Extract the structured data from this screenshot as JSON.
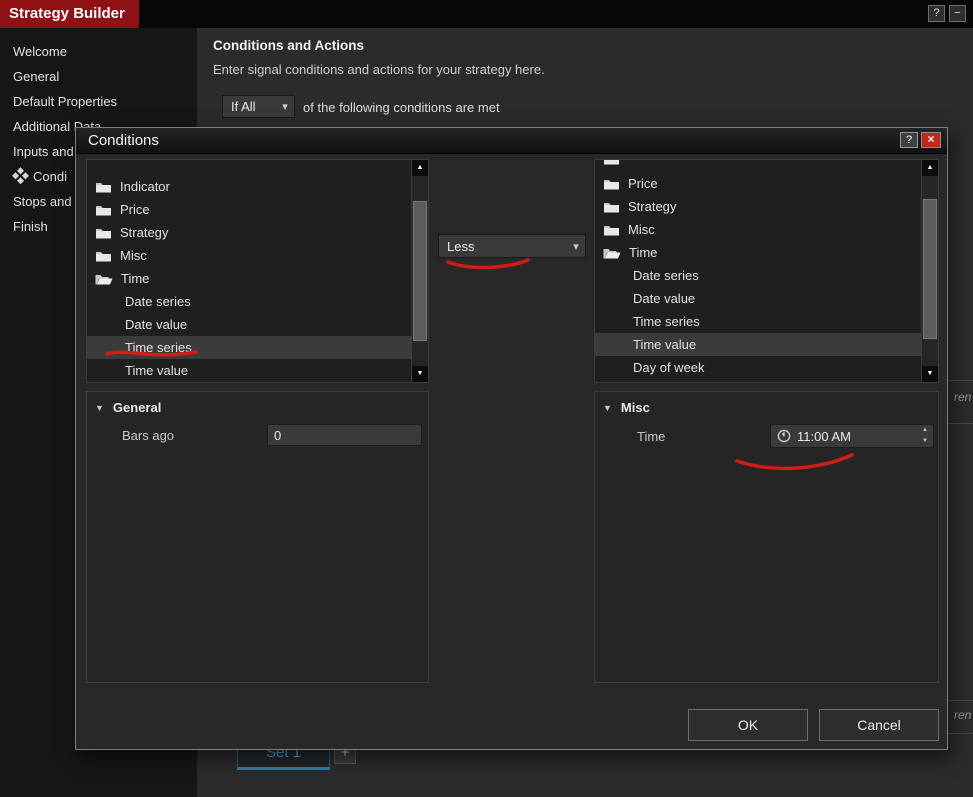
{
  "colors": {
    "titlebar_red": "#8f1113",
    "annotation_red": "#d21c17",
    "tab_blue": "#3f9fd8",
    "selection_gray": "#3b3b3b"
  },
  "icons": {
    "help": "?",
    "minimize": "−",
    "close": "×",
    "chevron_down": "▾",
    "scroll_up": "▲",
    "scroll_down": "▼",
    "spinner_up": "▲",
    "spinner_down": "▼",
    "group_collapsed": "▼",
    "add": "+",
    "current_step": "four-diamonds",
    "folder": "folder-shape",
    "folder_open": "open-folder-shape",
    "clock": "clock-face"
  },
  "window": {
    "title": "Strategy Builder"
  },
  "sidebar": {
    "items": [
      "Welcome",
      "General",
      "Default Properties",
      "Additional Data",
      "Inputs and",
      "Condi",
      "Stops and",
      "Finish"
    ]
  },
  "main": {
    "heading": "Conditions and Actions",
    "subheading": "Enter signal conditions and actions for your strategy here.",
    "match_select_value": "If All",
    "match_text": "of the following conditions are met",
    "set_tab_label": "Set 1",
    "edge_fragment_text": "ren"
  },
  "dialog": {
    "title": "Conditions",
    "left_tree": {
      "items": [
        {
          "label": "Indicator"
        },
        {
          "label": "Price"
        },
        {
          "label": "Strategy"
        },
        {
          "label": "Misc"
        },
        {
          "label": "Time",
          "expanded": true
        },
        {
          "label": "Date series"
        },
        {
          "label": "Date value"
        },
        {
          "label": "Time series",
          "selected": true
        },
        {
          "label": "Time value"
        }
      ]
    },
    "operator_value": "Less",
    "right_tree": {
      "items": [
        {
          "label": "Price"
        },
        {
          "label": "Strategy"
        },
        {
          "label": "Misc"
        },
        {
          "label": "Time",
          "expanded": true
        },
        {
          "label": "Date series"
        },
        {
          "label": "Date value"
        },
        {
          "label": "Time series"
        },
        {
          "label": "Time value",
          "selected": true
        },
        {
          "label": "Day of week"
        }
      ]
    },
    "left_group": {
      "title": "General",
      "field_label": "Bars ago",
      "field_value": "0"
    },
    "right_group": {
      "title": "Misc",
      "field_label": "Time",
      "time_value": "11:00 AM"
    },
    "ok_label": "OK",
    "cancel_label": "Cancel"
  }
}
